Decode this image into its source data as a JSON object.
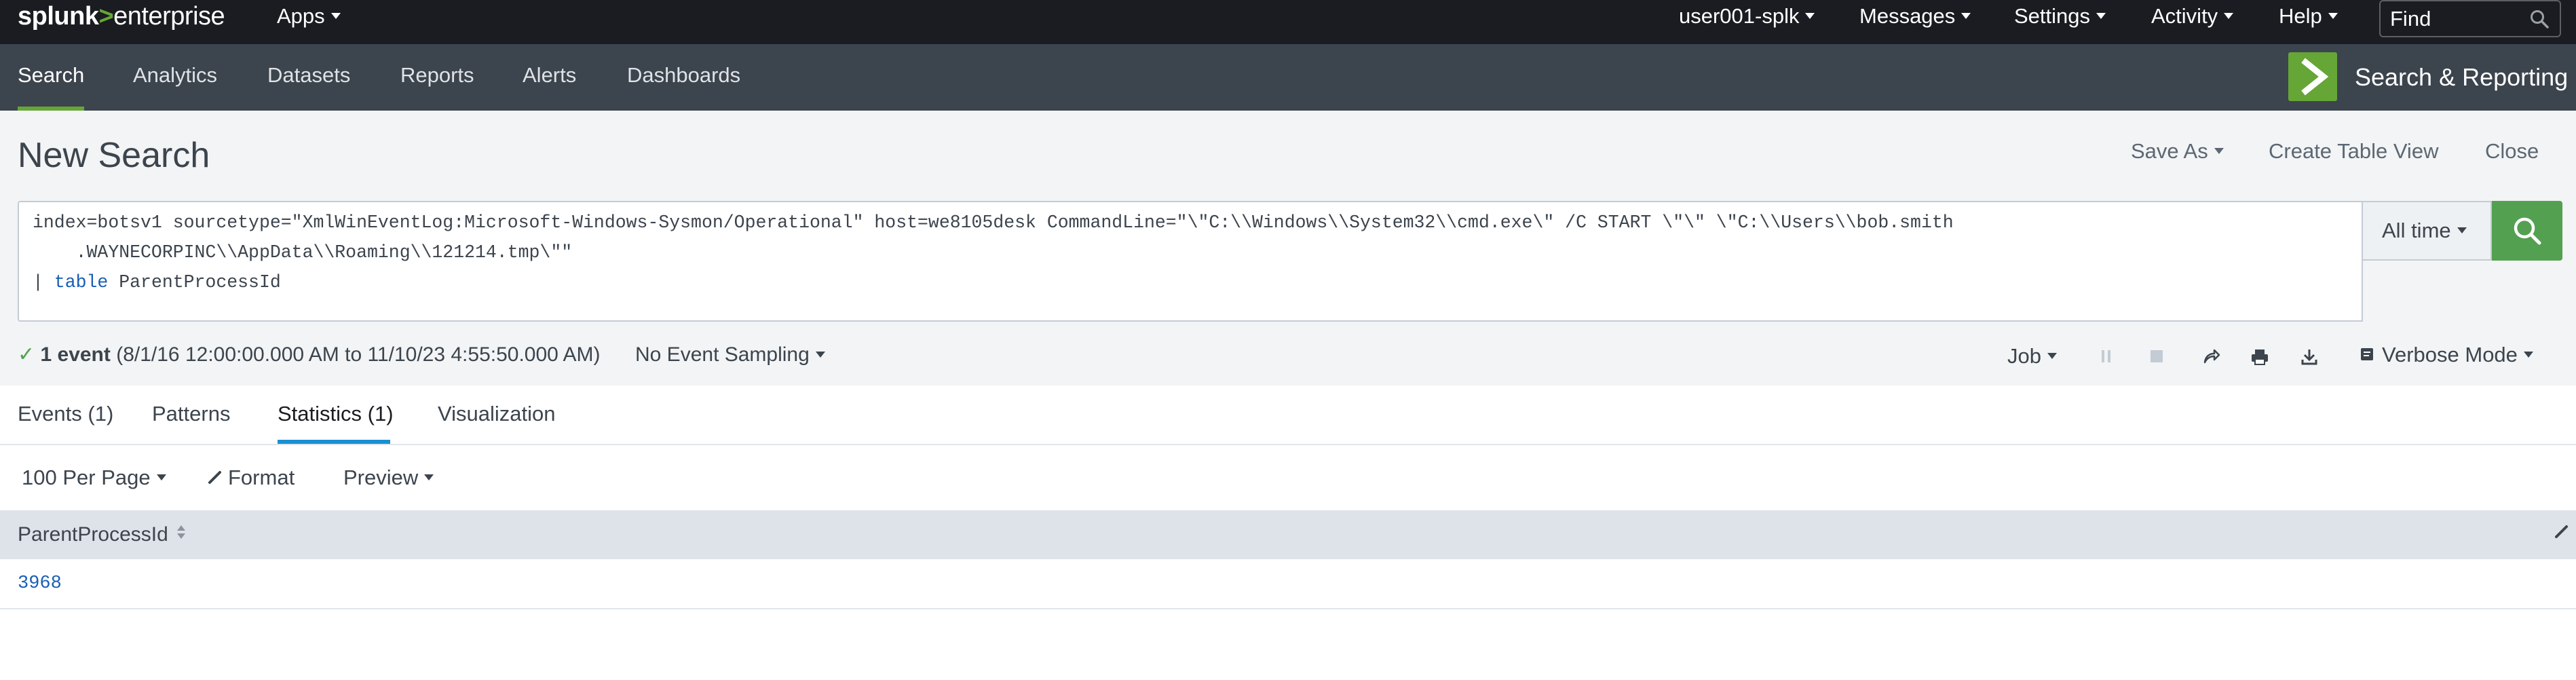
{
  "topbar": {
    "logo_primary": "splunk",
    "logo_separator": ">",
    "logo_secondary": "enterprise",
    "apps_label": "Apps",
    "user_label": "user001-splk",
    "messages_label": "Messages",
    "settings_label": "Settings",
    "activity_label": "Activity",
    "help_label": "Help",
    "find_placeholder": "Find"
  },
  "appnav": {
    "items": [
      {
        "label": "Search",
        "active": true
      },
      {
        "label": "Analytics",
        "active": false
      },
      {
        "label": "Datasets",
        "active": false
      },
      {
        "label": "Reports",
        "active": false
      },
      {
        "label": "Alerts",
        "active": false
      },
      {
        "label": "Dashboards",
        "active": false
      }
    ],
    "app_title": "Search & Reporting"
  },
  "search": {
    "page_title": "New Search",
    "save_as_label": "Save As",
    "create_table_view_label": "Create Table View",
    "close_label": "Close",
    "query_line1": "index=botsv1 sourcetype=\"XmlWinEventLog:Microsoft-Windows-Sysmon/Operational\" host=we8105desk CommandLine=\"\\\"C:\\\\Windows\\\\System32\\\\cmd.exe\\\" /C START \\\"\\\" \\\"C:\\\\Users\\\\bob.smith",
    "query_line2": "    .WAYNECORPINC\\\\AppData\\\\Roaming\\\\121214.tmp\\\"\"",
    "query_line3_pipe": "| ",
    "query_line3_command": "table",
    "query_line3_rest": " ParentProcessId",
    "time_range_label": "All time"
  },
  "status": {
    "event_count": "1 event",
    "time_range_detail": " (8/1/16 12:00:00.000 AM to 11/10/23 4:55:50.000 AM)",
    "sampling_label": "No Event Sampling",
    "job_label": "Job",
    "mode_label": "Verbose Mode"
  },
  "results_tabs": [
    {
      "label": "Events (1)",
      "active": false
    },
    {
      "label": "Patterns",
      "active": false
    },
    {
      "label": "Statistics (1)",
      "active": true
    },
    {
      "label": "Visualization",
      "active": false
    }
  ],
  "table_toolbar": {
    "per_page_label": "100 Per Page",
    "format_label": "Format",
    "preview_label": "Preview"
  },
  "table": {
    "columns": [
      "ParentProcessId"
    ],
    "rows": [
      [
        "3968"
      ]
    ]
  },
  "colors": {
    "topbar_bg": "#1a1c21",
    "appbar_bg": "#3c444d",
    "accent_green": "#65a637",
    "search_button_green": "#53a051",
    "active_tab_blue": "#1a8fd2",
    "link_blue": "#1a5fb4"
  }
}
